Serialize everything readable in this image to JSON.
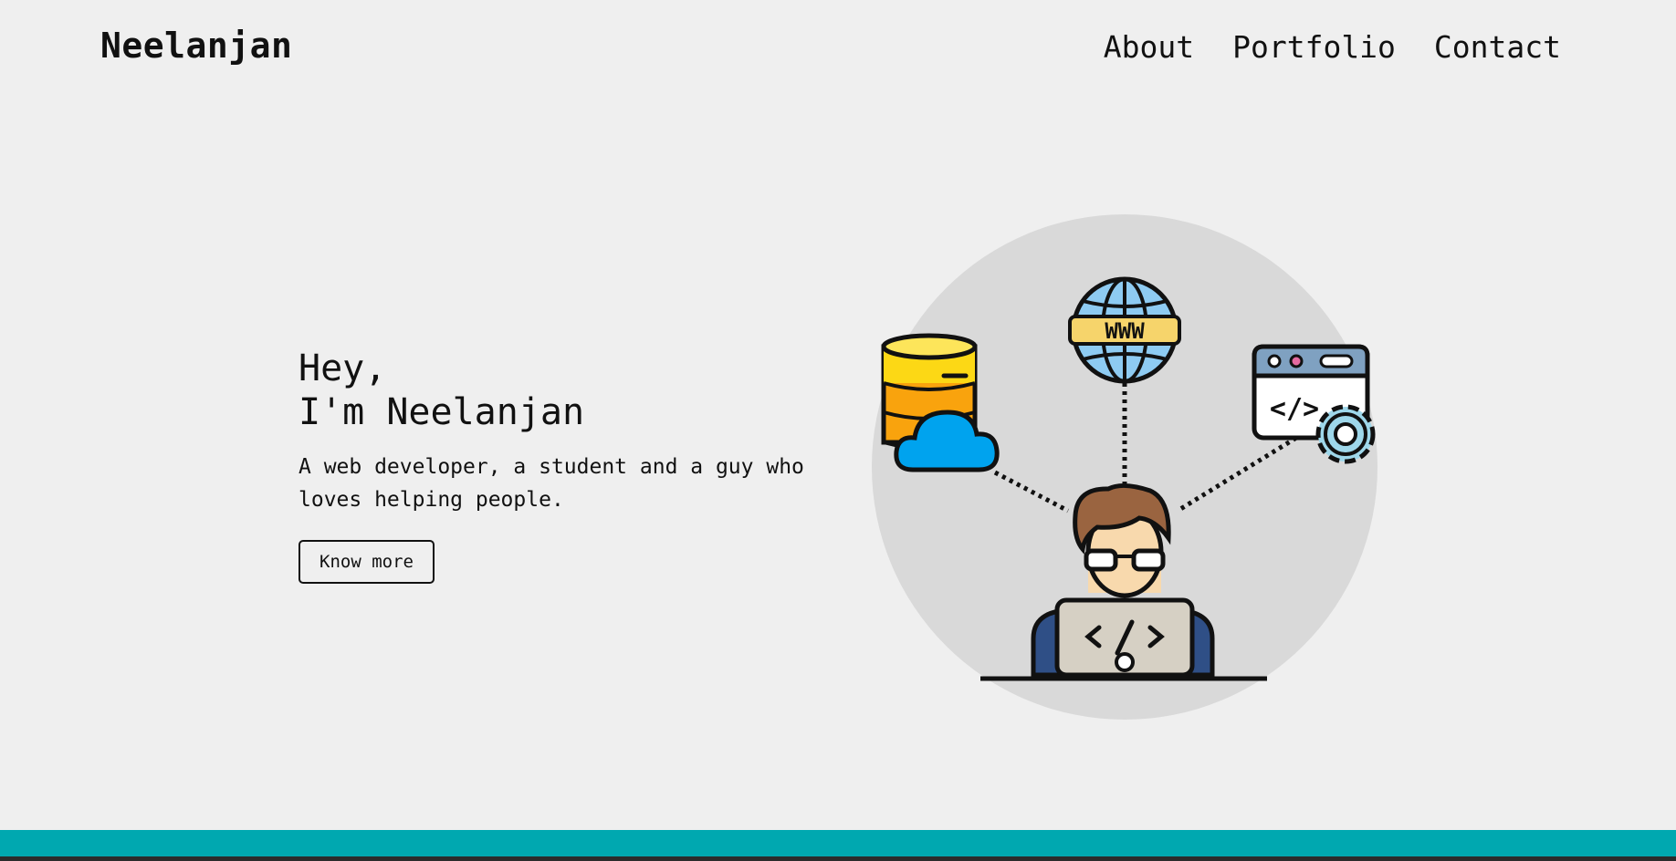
{
  "header": {
    "brand": "Neelanjan",
    "nav": [
      {
        "label": "About"
      },
      {
        "label": "Portfolio"
      },
      {
        "label": "Contact"
      }
    ]
  },
  "hero": {
    "greeting_line1": "Hey,",
    "greeting_line2": "I'm Neelanjan",
    "description": "A web developer, a student and a guy who loves helping people.",
    "cta_label": "Know more"
  },
  "illustration": {
    "globe_label": "WWW",
    "code_label": "</>"
  },
  "colors": {
    "background": "#efefef",
    "accent_bar": "#00a8b0",
    "circle": "#d9d9d9"
  }
}
